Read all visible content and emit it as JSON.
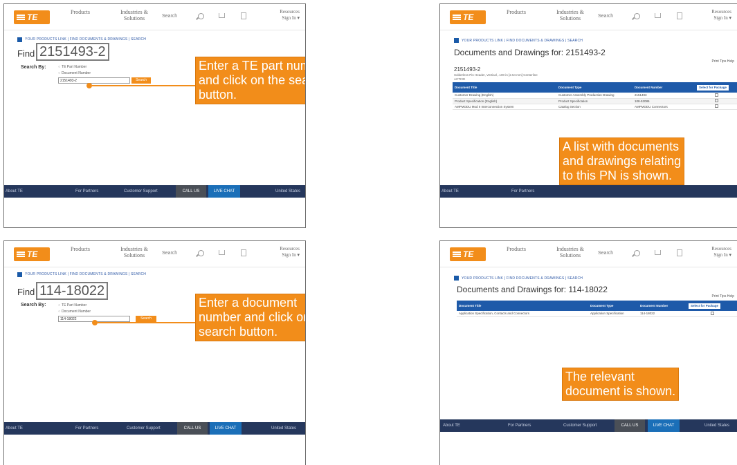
{
  "site": {
    "logo": "TE",
    "nav_products": "Products",
    "nav_industries": "Industries & Solutions",
    "search_placeholder": "Search",
    "resources": "Resources",
    "sign_in": "Sign In ▾"
  },
  "footer": {
    "about": "About TE",
    "for_partners": "For Partners",
    "customer_support": "Customer Support",
    "call_us": "CALL US",
    "live_chat": "LIVE CHAT",
    "region": "United States"
  },
  "breadcrumb": "YOUR PRODUCTS LINK | FIND DOCUMENTS & DRAWINGS | SEARCH",
  "panel1": {
    "find_label": "Find",
    "callout_value": "2151493-2",
    "search_by": "Search By:",
    "option_part": "TE Part Number",
    "option_doc": "Document Number",
    "input_value": "2151493-2",
    "search_button": "Search",
    "annotation": [
      "Enter a TE part number",
      "and click on the search",
      "button."
    ]
  },
  "panel2": {
    "title": "Documents and Drawings for: 2151493-2",
    "print_link": "Print Tips Help",
    "pn": "2151493-2",
    "pn_desc": "Solderless Pin Header, Vertical, .100 in [2.54 mm] Centerline",
    "pn_status": "ACTIVE",
    "columns": [
      "Document Title",
      "Document Type",
      "Document Number",
      "Select for Package"
    ],
    "rows": [
      [
        "Customer Drawing (English)",
        "Customer Assembly Production Drawing",
        "2151493",
        ""
      ],
      [
        "Product Specification (English)",
        "Product Specification",
        "108-52086",
        ""
      ],
      [
        "AMPMODU Mod II Interconnection System",
        "Catalog Section",
        "AMPMODU Connectors",
        ""
      ]
    ],
    "annotation": [
      "A list with documents",
      "and drawings relating",
      "to this PN is shown."
    ]
  },
  "panel3": {
    "find_label": "Find",
    "callout_value": "114-18022",
    "search_by": "Search By:",
    "option_part": "TE Part Number",
    "option_doc": "Document Number",
    "input_value": "114-18022",
    "search_button": "Search",
    "annotation": [
      "Enter a document",
      "number and click on the",
      "search button."
    ]
  },
  "panel4": {
    "title": "Documents and Drawings for: 114-18022",
    "print_link": "Print Tips Help",
    "columns": [
      "Document Title",
      "Document Type",
      "Document Number",
      "Select for Package"
    ],
    "rows": [
      [
        "Application Specification, Contacts and Connectors",
        "Application Specification",
        "114-18022",
        ""
      ]
    ],
    "annotation": [
      "The relevant",
      "document is shown."
    ]
  }
}
